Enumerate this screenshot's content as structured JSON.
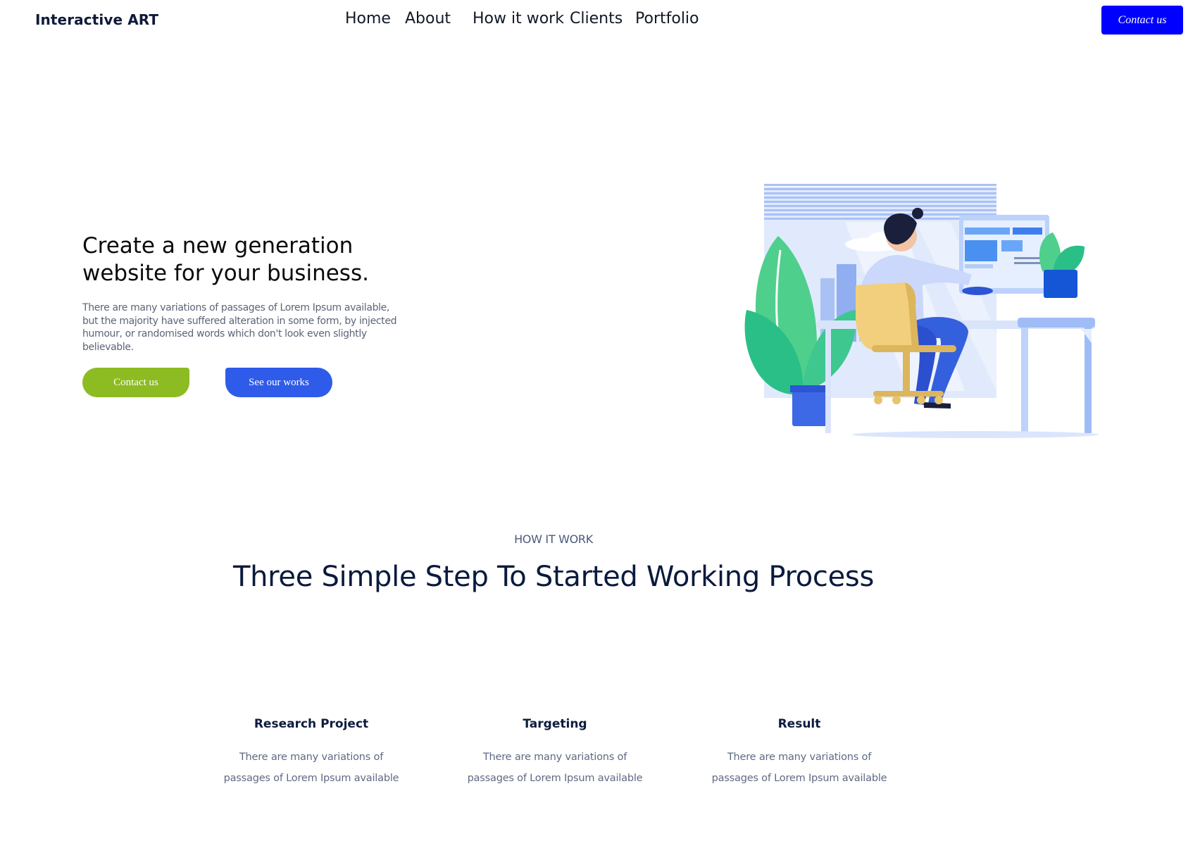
{
  "header": {
    "logo": "Interactive ART",
    "nav": [
      "Home",
      "About",
      "How it work",
      "Clients",
      "Portfolio"
    ],
    "contact_button": "Contact us"
  },
  "hero": {
    "title_line1": "Create a new generation",
    "title_line2": "website for your business.",
    "description": "There are many variations of passages of Lorem Ipsum available, but the majority have suffered alteration in some form, by injected humour, or randomised words which don't look even slightly believable.",
    "primary_button": "Contact us",
    "secondary_button": "See our works"
  },
  "how_it_work": {
    "eyebrow": "HOW IT WORK",
    "title": "Three Simple Step To Started Working Process",
    "steps": [
      {
        "title": "Research Project",
        "text_line1": "There are many variations of",
        "text_line2": "passages of Lorem Ipsum available"
      },
      {
        "title": "Targeting",
        "text_line1": "There are many variations of",
        "text_line2": "passages of Lorem Ipsum available"
      },
      {
        "title": "Result",
        "text_line1": "There are many variations of",
        "text_line2": "passages of Lorem Ipsum available"
      }
    ]
  },
  "colors": {
    "accent_blue": "#0000ff",
    "button_green": "#8cbc22",
    "button_blue": "#2f5bea",
    "text_dark": "#0d1b3e"
  }
}
